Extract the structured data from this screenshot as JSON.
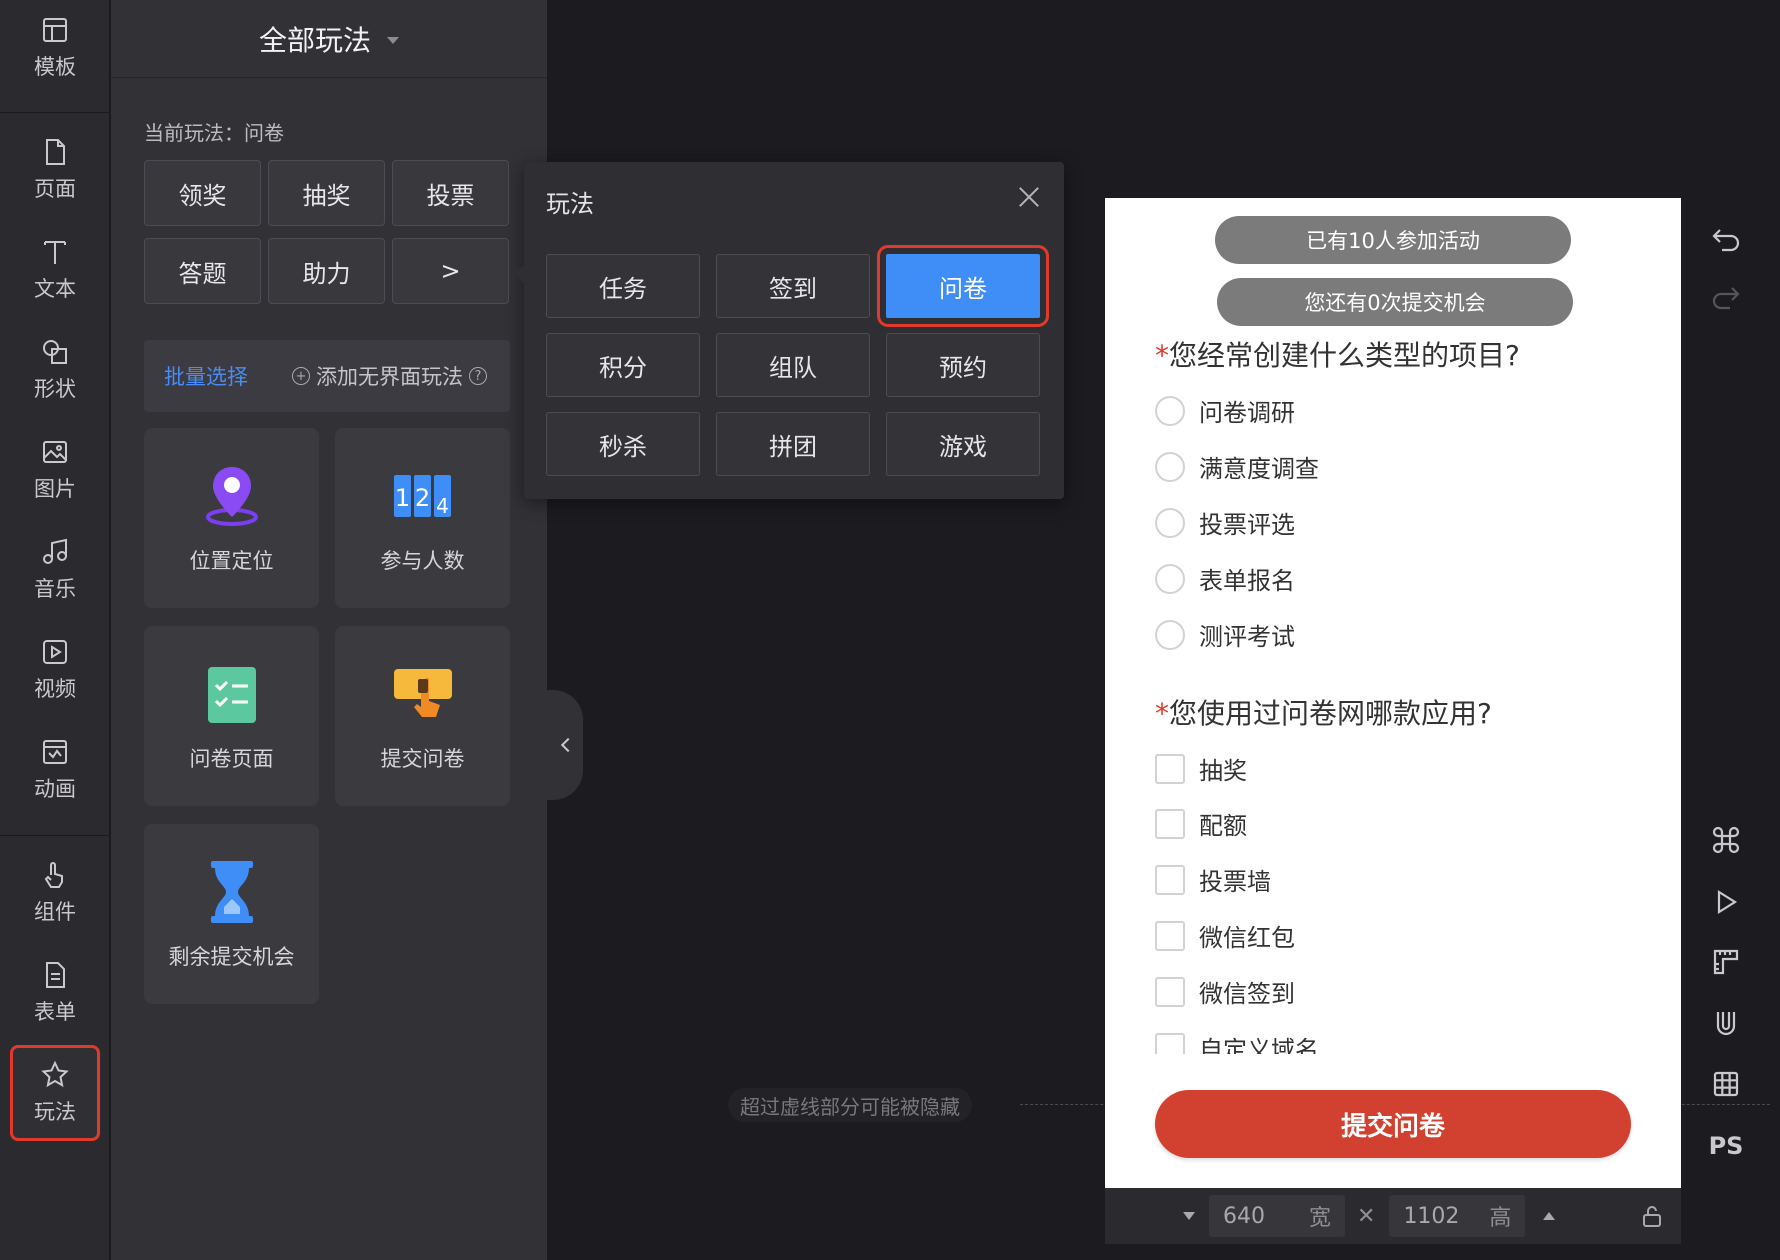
{
  "rail": {
    "items": [
      {
        "label": "模板"
      },
      {
        "label": "页面"
      },
      {
        "label": "文本"
      },
      {
        "label": "形状"
      },
      {
        "label": "图片"
      },
      {
        "label": "音乐"
      },
      {
        "label": "视频"
      },
      {
        "label": "动画"
      },
      {
        "label": "组件"
      },
      {
        "label": "表单"
      },
      {
        "label": "玩法"
      }
    ],
    "active": "玩法"
  },
  "panel": {
    "header_title": "全部玩法",
    "current_label": "当前玩法：问卷",
    "modes": [
      "领奖",
      "抽奖",
      "投票",
      "答题",
      "助力",
      ">"
    ],
    "batch_select": "批量选择",
    "add_free": "添加无界面玩法",
    "cards": [
      {
        "label": "位置定位",
        "icon": "location-pin-icon"
      },
      {
        "label": "参与人数",
        "icon": "counter-124-icon"
      },
      {
        "label": "问卷页面",
        "icon": "checklist-icon"
      },
      {
        "label": "提交问卷",
        "icon": "tap-button-icon"
      },
      {
        "label": "剩余提交机会",
        "icon": "hourglass-icon"
      }
    ]
  },
  "popup": {
    "title": "玩法",
    "options": [
      "任务",
      "签到",
      "问卷",
      "积分",
      "组队",
      "预约",
      "秒杀",
      "拼团",
      "游戏"
    ],
    "selected": "问卷"
  },
  "canvas": {
    "hint": "超过虚线部分可能被隐藏"
  },
  "preview": {
    "participants_pill": "已有10人参加活动",
    "chances_pill": "您还有0次提交机会",
    "q1": {
      "required": "*",
      "title": "您经常创建什么类型的项目?",
      "options": [
        "问卷调研",
        "满意度调查",
        "投票评选",
        "表单报名",
        "测评考试"
      ]
    },
    "q2": {
      "required": "*",
      "title": "您使用过问卷网哪款应用?",
      "options": [
        "抽奖",
        "配额",
        "投票墙",
        "微信红包",
        "微信签到",
        "自定义域名"
      ]
    },
    "submit": "提交问卷"
  },
  "sizebar": {
    "width": "640",
    "width_unit": "宽",
    "height": "1102",
    "height_unit": "高"
  },
  "right_toolbar": {
    "ps_label": "PS"
  },
  "colors": {
    "accent_blue": "#3f8ef7",
    "highlight_red": "#e03a2c",
    "submit_red": "#d2412f"
  }
}
